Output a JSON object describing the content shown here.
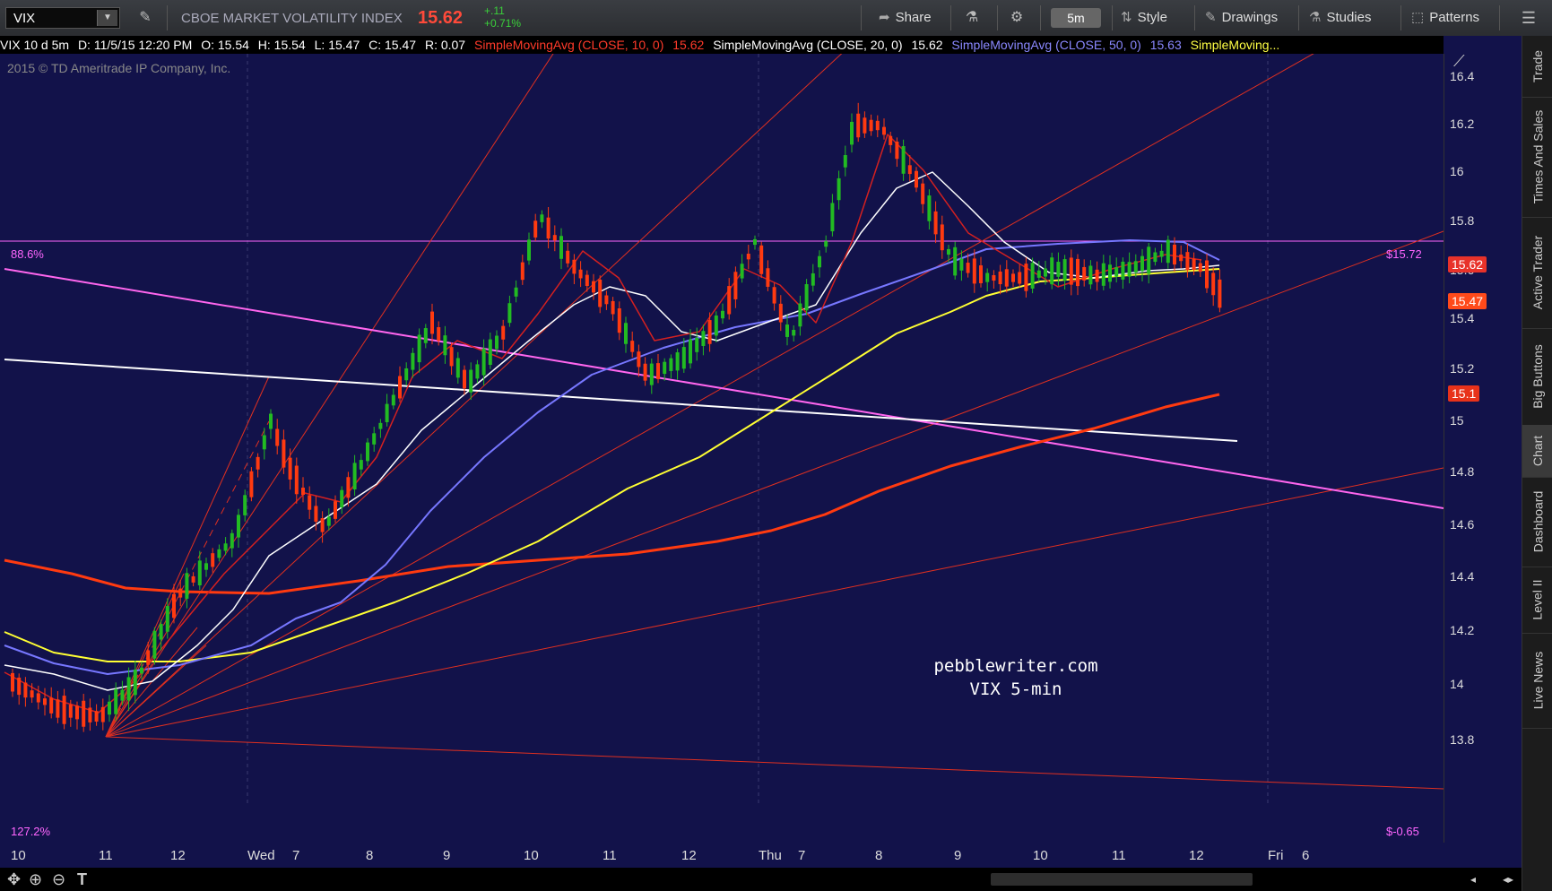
{
  "toolbar": {
    "symbol": "VIX",
    "index_name": "CBOE MARKET VOLATILITY INDEX",
    "last_price": "15.62",
    "change_abs": "+.11",
    "change_pct": "+0.71%",
    "share_label": "Share",
    "aggregation": "5m",
    "style_label": "Style",
    "drawings_label": "Drawings",
    "studies_label": "Studies",
    "patterns_label": "Patterns"
  },
  "header": {
    "descriptor": "VIX 10 d 5m",
    "date": "D: 11/5/15 12:20 PM",
    "open": "O: 15.54",
    "high": "H: 15.54",
    "low": "L: 15.47",
    "close": "C: 15.47",
    "range": "R: 0.07",
    "sma10_label": "SimpleMovingAvg (CLOSE, 10, 0)",
    "sma10_value": "15.62",
    "sma20_label": "SimpleMovingAvg (CLOSE, 20, 0)",
    "sma20_value": "15.62",
    "sma50_label": "SimpleMovingAvg (CLOSE, 50, 0)",
    "sma50_value": "15.63",
    "sma_more_label": "SimpleMoving..."
  },
  "copyright": "2015 © TD Ameritrade IP Company, Inc.",
  "fib": {
    "top_left": "88.6%",
    "top_right": "$15.72",
    "bottom_left": "127.2%",
    "bottom_right": "$-0.65"
  },
  "watermark": {
    "line1": "pebblewriter.com",
    "line2": "VIX 5-min"
  },
  "price_axis": {
    "ticks": [
      "16.4",
      "16.2",
      "16",
      "15.8",
      "15.6",
      "15.4",
      "15.2",
      "15",
      "14.8",
      "14.6",
      "14.4",
      "14.2",
      "14",
      "13.8"
    ],
    "badges": [
      {
        "label": "15.62",
        "color": "#e8322a"
      },
      {
        "label": "15.47",
        "color": "#ff4a1a"
      },
      {
        "label": "15.1",
        "color": "#e8321a"
      }
    ]
  },
  "time_axis": {
    "ticks": [
      "10",
      "11",
      "12",
      "Wed",
      "7",
      "8",
      "9",
      "10",
      "11",
      "12",
      "Thu",
      "7",
      "8",
      "9",
      "10",
      "11",
      "12",
      "Fri",
      "6"
    ]
  },
  "sidebar": {
    "tabs": [
      "Trade",
      "Times And Sales",
      "Active Trader",
      "Big Buttons",
      "Chart",
      "Dashboard",
      "Level II",
      "Live News"
    ]
  },
  "colors": {
    "background": "#12124a",
    "sma10": "#d42020",
    "sma20": "#ffffff",
    "sma50": "#7777ff",
    "sma100": "#ffff33",
    "sma200": "#ff3a10",
    "fib_line": "#ff66ff",
    "up_candle": "#22bb22",
    "down_candle": "#ff3a10"
  }
}
